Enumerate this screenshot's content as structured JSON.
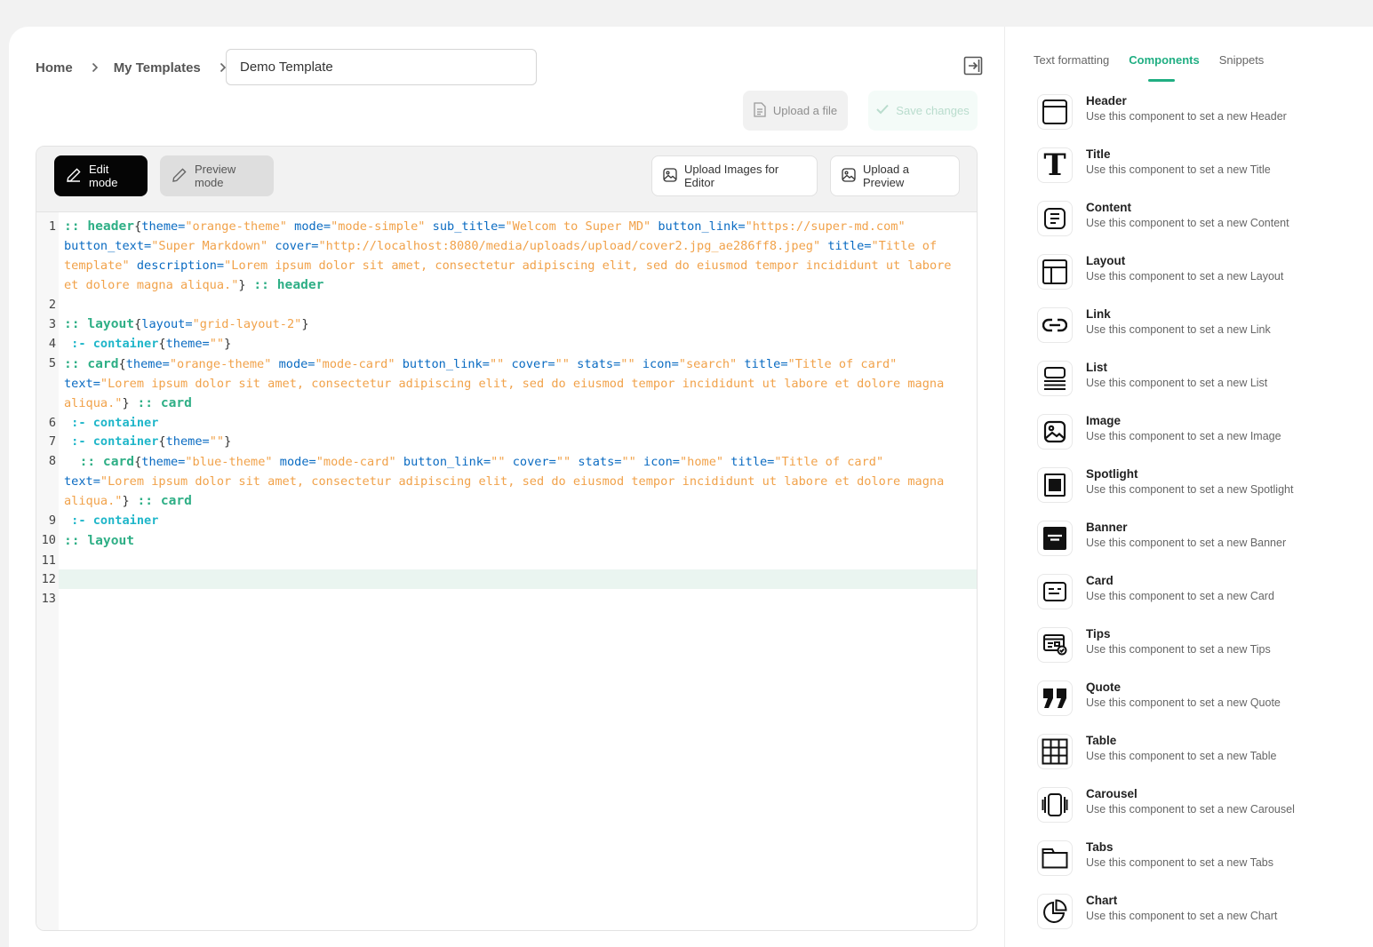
{
  "breadcrumb": {
    "home": "Home",
    "templates": "My Templates"
  },
  "template_name": "Demo Template",
  "actions": {
    "upload_file": "Upload a file",
    "save_changes": "Save changes"
  },
  "editor": {
    "edit_mode": "Edit mode",
    "preview_mode": "Preview mode",
    "upload_images": "Upload Images for Editor",
    "upload_preview": "Upload a Preview",
    "line_numbers": [
      "1",
      "2",
      "3",
      "4",
      "5",
      "6",
      "7",
      "8",
      "9",
      "10",
      "11",
      "12",
      "13"
    ],
    "code": {
      "l1a": ":: header",
      "l1b": "{",
      "l1c": "theme=",
      "l1d": "\"orange-theme\"",
      "l1e": " mode=",
      "l1f": "\"mode-simple\"",
      "l1g": " sub_title=",
      "l1h": "\"Welcom to Super MD\"",
      "l1i": " button_link=",
      "l1j": "\"https://super-md.com\"",
      "l1k": "button_text=",
      "l1l": "\"Super Markdown\"",
      "l1m": " cover=",
      "l1n": "\"http://localhost:8080/media/uploads/upload/cover2.jpg_ae286ff8.jpeg\"",
      "l1o": " title=",
      "l1p": "\"Title of",
      "l1q": "template\"",
      "l1r": " description=",
      "l1s": "\"Lorem ipsum dolor sit amet, consectetur adipiscing elit, sed do eiusmod tempor incididunt ut labore",
      "l1t": "et dolore magna aliqua.\"",
      "l1u": "}",
      "l1v": " :: header",
      "l3a": ":: layout",
      "l3b": "{",
      "l3c": "layout=",
      "l3d": "\"grid-layout-2\"",
      "l3e": "}",
      "l4a": " :- container",
      "l4b": "{",
      "l4c": "theme=",
      "l4d": "\"\"",
      "l4e": "}",
      "l5a": ":: card",
      "l5b": "{",
      "l5c": "theme=",
      "l5d": "\"orange-theme\"",
      "l5e": " mode=",
      "l5f": "\"mode-card\"",
      "l5g": " button_link=",
      "l5h": "\"\"",
      "l5i": " cover=",
      "l5j": "\"\"",
      "l5k": " stats=",
      "l5l": "\"\"",
      "l5m": " icon=",
      "l5n": "\"search\"",
      "l5o": " title=",
      "l5p": "\"Title of card\"",
      "l5q": "text=",
      "l5r": "\"Lorem ipsum dolor sit amet, consectetur adipiscing elit, sed do eiusmod tempor incididunt ut labore et dolore magna",
      "l5s": "aliqua.\"",
      "l5t": "}",
      "l5u": " :: card",
      "l6a": " :- container",
      "l7a": " :- container",
      "l7b": "{",
      "l7c": "theme=",
      "l7d": "\"\"",
      "l7e": "}",
      "l8a": "  :: card",
      "l8b": "{",
      "l8c": "theme=",
      "l8d": "\"blue-theme\"",
      "l8e": " mode=",
      "l8f": "\"mode-card\"",
      "l8g": " button_link=",
      "l8h": "\"\"",
      "l8i": " cover=",
      "l8j": "\"\"",
      "l8k": " stats=",
      "l8l": "\"\"",
      "l8m": " icon=",
      "l8n": "\"home\"",
      "l8o": " title=",
      "l8p": "\"Title of card\"",
      "l8q": "text=",
      "l8r": "\"Lorem ipsum dolor sit amet, consectetur adipiscing elit, sed do eiusmod tempor incididunt ut labore et dolore magna",
      "l8s": "aliqua.\"",
      "l8t": "}",
      "l8u": " :: card",
      "l9a": " :- container",
      "l10a": ":: layout"
    }
  },
  "sidebar": {
    "tabs": [
      "Text formatting",
      "Components",
      "Snippets"
    ],
    "active_tab": "Components",
    "components": [
      {
        "name": "Header",
        "desc": "Use this component to set a new Header",
        "icon": "header-icon"
      },
      {
        "name": "Title",
        "desc": "Use this component to set a new Title",
        "icon": "title-icon"
      },
      {
        "name": "Content",
        "desc": "Use this component to set a new Content",
        "icon": "content-icon"
      },
      {
        "name": "Layout",
        "desc": "Use this component to set a new Layout",
        "icon": "layout-icon"
      },
      {
        "name": "Link",
        "desc": "Use this component to set a new Link",
        "icon": "link-icon"
      },
      {
        "name": "List",
        "desc": "Use this component to set a new List",
        "icon": "list-icon"
      },
      {
        "name": "Image",
        "desc": "Use this component to set a new Image",
        "icon": "image-icon"
      },
      {
        "name": "Spotlight",
        "desc": "Use this component to set a new Spotlight",
        "icon": "spotlight-icon"
      },
      {
        "name": "Banner",
        "desc": "Use this component to set a new Banner",
        "icon": "banner-icon"
      },
      {
        "name": "Card",
        "desc": "Use this component to set a new Card",
        "icon": "card-icon"
      },
      {
        "name": "Tips",
        "desc": "Use this component to set a new Tips",
        "icon": "tips-icon"
      },
      {
        "name": "Quote",
        "desc": "Use this component to set a new Quote",
        "icon": "quote-icon"
      },
      {
        "name": "Table",
        "desc": "Use this component to set a new Table",
        "icon": "table-icon"
      },
      {
        "name": "Carousel",
        "desc": "Use this component to set a new Carousel",
        "icon": "carousel-icon"
      },
      {
        "name": "Tabs",
        "desc": "Use this component to set a new Tabs",
        "icon": "tabs-icon"
      },
      {
        "name": "Chart",
        "desc": "Use this component to set a new Chart",
        "icon": "chart-icon"
      }
    ]
  },
  "colors": {
    "accent": "#1fae82",
    "keyword": "#2faf86",
    "attr": "#0a6bc2",
    "string": "#f1a24a",
    "container": "#1fb6c9"
  }
}
